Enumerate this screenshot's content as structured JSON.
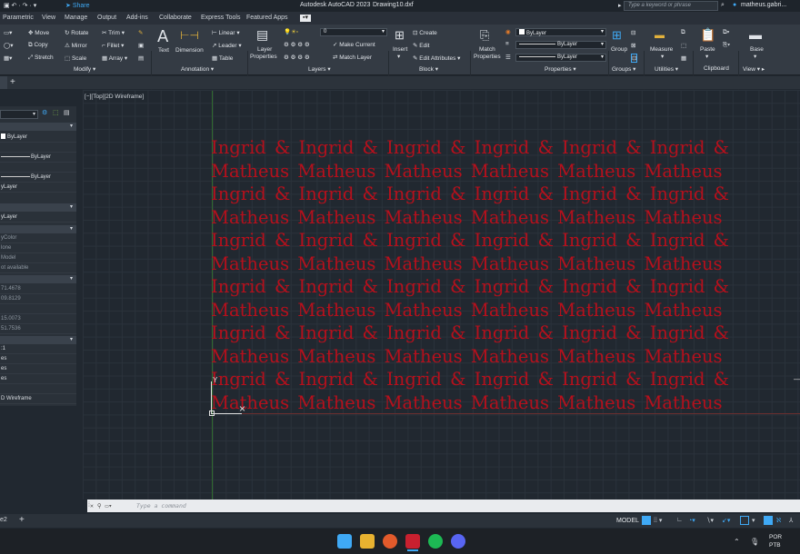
{
  "window": {
    "title": "Autodesk AutoCAD 2023",
    "filename": "Drawing10.dxf",
    "share_label": "Share",
    "search_placeholder": "Type a keyword or phrase",
    "user": "matheus.gabri..."
  },
  "menu": [
    "Parametric",
    "View",
    "Manage",
    "Output",
    "Add-ins",
    "Collaborate",
    "Express Tools",
    "Featured Apps"
  ],
  "ribbon": {
    "modify": {
      "title": "Modify",
      "items": [
        "Move",
        "Rotate",
        "Trim",
        "Copy",
        "Mirror",
        "Fillet",
        "Stretch",
        "Scale",
        "Array"
      ]
    },
    "annotation": {
      "title": "Annotation",
      "text": "Text",
      "dimension": "Dimension",
      "linear": "Linear",
      "leader": "Leader",
      "table": "Table"
    },
    "layers": {
      "title": "Layers",
      "layer_properties": "Layer Properties",
      "current_layer": "0",
      "make_current": "Make Current",
      "match_layer": "Match Layer"
    },
    "block": {
      "title": "Block",
      "insert": "Insert",
      "create": "Create",
      "edit": "Edit",
      "edit_attributes": "Edit Attributes"
    },
    "properties": {
      "title": "Properties",
      "match_properties": "Match Properties",
      "color": "ByLayer",
      "lineweight": "ByLayer",
      "linetype": "ByLayer"
    },
    "groups": {
      "title": "Groups",
      "group": "Group"
    },
    "utilities": {
      "title": "Utilities",
      "measure": "Measure"
    },
    "clipboard": {
      "title": "Clipboard",
      "paste": "Paste"
    },
    "view": {
      "title": "View",
      "base": "Base"
    }
  },
  "viewport_label": "[−][Top][2D Wireframe]",
  "properties_palette": {
    "rows": [
      {
        "value": "ByLayer",
        "dim": false
      },
      {
        "value": "ByLayer",
        "dim": false
      },
      {
        "value": "ByLayer",
        "dim": false
      },
      {
        "value": "yLayer",
        "dim": false
      },
      {
        "value": "yLayer",
        "dim": false
      },
      {
        "value": "yColor",
        "dim": true
      },
      {
        "value": "lone",
        "dim": true
      },
      {
        "value": "Model",
        "dim": true
      },
      {
        "value": "ot available",
        "dim": true
      },
      {
        "value": "71.4678",
        "dim": true
      },
      {
        "value": "09.8129",
        "dim": true
      },
      {
        "value": "15.0073",
        "dim": true
      },
      {
        "value": "51.7536",
        "dim": true
      },
      {
        "value": ":1",
        "dim": false
      },
      {
        "value": "es",
        "dim": false
      },
      {
        "value": "es",
        "dim": false
      },
      {
        "value": "es",
        "dim": false
      },
      {
        "value": "D Wireframe",
        "dim": false
      }
    ]
  },
  "drawing": {
    "color": "#b5101c",
    "lines": [
      "Ingrid & Ingrid & Ingrid & Ingrid & Ingrid & Ingrid &",
      "Matheus Matheus Matheus Matheus Matheus Matheus",
      "Ingrid & Ingrid & Ingrid & Ingrid & Ingrid & Ingrid &",
      "Matheus Matheus Matheus Matheus Matheus Matheus",
      "Ingrid & Ingrid & Ingrid & Ingrid & Ingrid & Ingrid &",
      "Matheus Matheus Matheus Matheus Matheus Matheus",
      "Ingrid & Ingrid & Ingrid & Ingrid & Ingrid & Ingrid &",
      "Matheus Matheus Matheus Matheus Matheus Matheus",
      "Ingrid & Ingrid & Ingrid & Ingrid & Ingrid & Ingrid &",
      "Matheus Matheus Matheus Matheus Matheus Matheus",
      "Ingrid & Ingrid & Ingrid & Ingrid & Ingrid & Ingrid &",
      "Matheus Matheus Matheus Matheus Matheus Matheus"
    ]
  },
  "command": {
    "placeholder": "Type a command"
  },
  "layout_tab": "e2",
  "status": {
    "model": "MODEL"
  },
  "taskbar": {
    "lang": "POR",
    "layout": "PTB"
  }
}
